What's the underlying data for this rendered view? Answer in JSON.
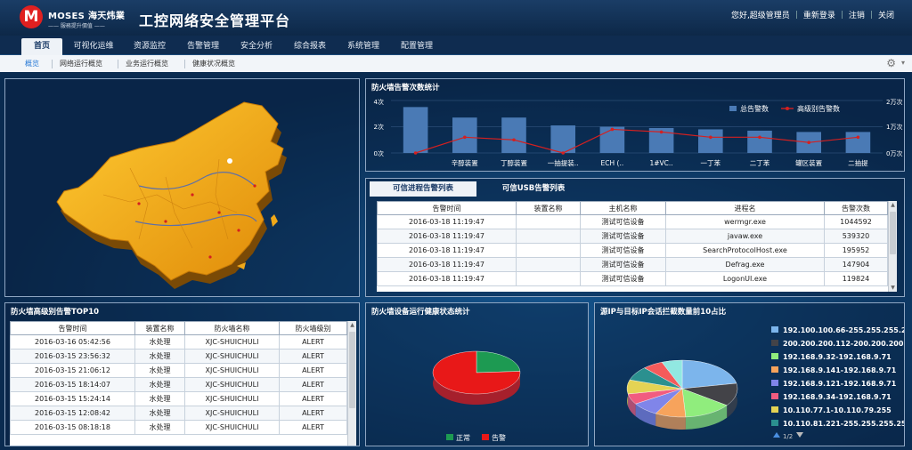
{
  "header": {
    "logo_letter": "M",
    "logo_text": "MOSES 海天炜業",
    "logo_tagline": "—— 服務提升價值 ——",
    "title": "工控网络安全管理平台",
    "welcome": "您好,超级管理员",
    "relogin": "重新登录",
    "logout": "注销",
    "close": "关闭"
  },
  "main_nav": [
    "首页",
    "可视化运维",
    "资源监控",
    "告警管理",
    "安全分析",
    "综合报表",
    "系统管理",
    "配置管理"
  ],
  "sub_nav": [
    "概览",
    "网络运行概览",
    "业务运行概览",
    "健康状况概览"
  ],
  "firewall_chart": {
    "title": "防火墙告警次数统计",
    "legend_total": "总告警数",
    "legend_high": "高级别告警数",
    "left_ticks": [
      "4次",
      "2次",
      "0次"
    ],
    "right_ticks": [
      "2万次",
      "1万次",
      "0万次"
    ]
  },
  "chart_data": [
    {
      "type": "bar",
      "title": "防火墙告警次数统计",
      "categories": [
        "",
        "辛醇装置",
        "丁醇装置",
        "一抽提装..",
        "ECH (..",
        "1#VC..",
        "一丁苯",
        "二丁苯",
        "罐区装置",
        "二抽提"
      ],
      "series": [
        {
          "name": "总告警数",
          "values": [
            3.5,
            2.7,
            2.7,
            2.1,
            2.0,
            1.9,
            1.8,
            1.7,
            1.6,
            1.6
          ]
        },
        {
          "name": "高级别告警数",
          "values": [
            0,
            0.6,
            0.5,
            0,
            0.9,
            0.8,
            0.6,
            0.6,
            0.4,
            0.6
          ]
        }
      ],
      "ylim": [
        0,
        4
      ],
      "y2lim": [
        0,
        2
      ],
      "legend": "top-right"
    },
    {
      "type": "pie",
      "title": "防火墙设备运行健康状态统计",
      "series": [
        {
          "name": "正常",
          "values": [
            24
          ]
        },
        {
          "name": "告警",
          "values": [
            76
          ]
        }
      ],
      "colors": [
        "#1d9a52",
        "#e81818"
      ],
      "legend": "bottom"
    },
    {
      "type": "pie",
      "title": "源IP与目标IP会话拦截数量前10占比",
      "categories": [
        "192.100.100.66-255.255.255.2",
        "200.200.200.112-200.200.200",
        "192.168.9.32-192.168.9.71",
        "192.168.9.141-192.168.9.71",
        "192.168.9.121-192.168.9.71",
        "192.168.9.34-192.168.9.71",
        "10.110.77.1-10.110.79.255",
        "10.110.81.221-255.255.255.25"
      ],
      "values": [
        22,
        13,
        14,
        9,
        8,
        6,
        8,
        8,
        6,
        6
      ],
      "colors": [
        "#7cb5ec",
        "#434348",
        "#90ed7d",
        "#f7a35c",
        "#8085e9",
        "#f15c80",
        "#e4d354",
        "#2b908f",
        "#f45b5b",
        "#91e8e1"
      ],
      "legend": "right",
      "pager": "1/2"
    }
  ],
  "tabs": {
    "active": "可信进程告警列表",
    "inactive": "可信USB告警列表"
  },
  "process_table": {
    "headers": [
      "告警时间",
      "装置名称",
      "主机名称",
      "进程名",
      "告警次数"
    ],
    "rows": [
      [
        "2016-03-18 11:19:47",
        "",
        "测试可信设备",
        "wermgr.exe",
        "1044592"
      ],
      [
        "2016-03-18 11:19:47",
        "",
        "测试可信设备",
        "javaw.exe",
        "539320"
      ],
      [
        "2016-03-18 11:19:47",
        "",
        "测试可信设备",
        "SearchProtocolHost.exe",
        "195952"
      ],
      [
        "2016-03-18 11:19:47",
        "",
        "测试可信设备",
        "Defrag.exe",
        "147904"
      ],
      [
        "2016-03-18 11:19:47",
        "",
        "测试可信设备",
        "LogonUI.exe",
        "119824"
      ]
    ]
  },
  "fw_high_table": {
    "title": "防火墙高级别告警TOP10",
    "headers": [
      "告警时间",
      "装置名称",
      "防火墙名称",
      "防火墙级别"
    ],
    "rows": [
      [
        "2016-03-16 05:42:56",
        "水处理",
        "XJC-SHUICHULI",
        "ALERT"
      ],
      [
        "2016-03-15 23:56:32",
        "水处理",
        "XJC-SHUICHULI",
        "ALERT"
      ],
      [
        "2016-03-15 21:06:12",
        "水处理",
        "XJC-SHUICHULI",
        "ALERT"
      ],
      [
        "2016-03-15 18:14:07",
        "水处理",
        "XJC-SHUICHULI",
        "ALERT"
      ],
      [
        "2016-03-15 15:24:14",
        "水处理",
        "XJC-SHUICHULI",
        "ALERT"
      ],
      [
        "2016-03-15 12:08:42",
        "水处理",
        "XJC-SHUICHULI",
        "ALERT"
      ],
      [
        "2016-03-15 08:18:18",
        "水处理",
        "XJC-SHUICHULI",
        "ALERT"
      ]
    ]
  },
  "health_title": "防火墙设备运行健康状态统计",
  "session_title": "源IP与目标IP会话拦截数量前10占比",
  "colors": {
    "accent": "#2b7bd6",
    "bar": "#4a7ab5",
    "line": "#d42020",
    "map": "#f0a818"
  }
}
